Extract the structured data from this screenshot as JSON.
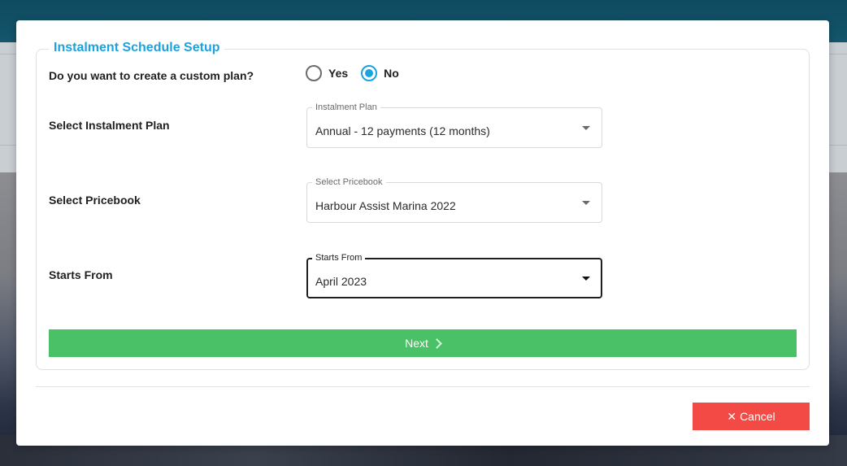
{
  "modal": {
    "title": "Instalment Schedule Setup",
    "custom_plan": {
      "question": "Do you want to create a custom plan?",
      "options": [
        {
          "label": "Yes",
          "checked": false
        },
        {
          "label": "No",
          "checked": true
        }
      ]
    },
    "instalment_plan": {
      "row_label": "Select Instalment Plan",
      "field_label": "Instalment Plan",
      "value": "Annual - 12 payments (12 months)"
    },
    "pricebook": {
      "row_label": "Select Pricebook",
      "field_label": "Select Pricebook",
      "value": "Harbour Assist Marina 2022"
    },
    "starts_from": {
      "row_label": "Starts From",
      "field_label": "Starts From",
      "value": "April 2023"
    },
    "next_label": "Next",
    "cancel_label": "Cancel"
  },
  "colors": {
    "accent": "#1aa3df",
    "next_button": "#4ac067",
    "cancel_button": "#f44a45",
    "top_bar": "#14566c"
  },
  "icons": {
    "next": "chevron-right-icon",
    "cancel": "close-icon",
    "dropdown": "caret-down-icon"
  }
}
